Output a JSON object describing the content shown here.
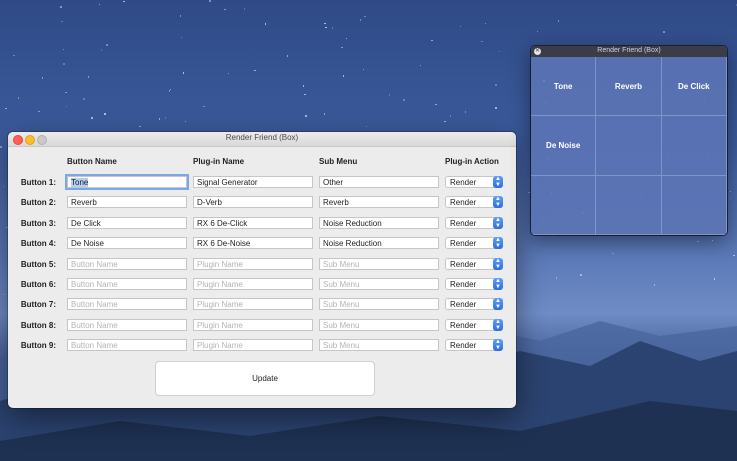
{
  "main_window": {
    "title": "Render Friend (Box)",
    "headers": {
      "button_name": "Button Name",
      "plugin_name": "Plug-in Name",
      "sub_menu": "Sub Menu",
      "plugin_action": "Plug-in Action"
    },
    "rows": [
      {
        "label": "Button 1:",
        "button_name": "Tone",
        "plugin_name": "Signal Generator",
        "sub_menu": "Other",
        "action": "Render"
      },
      {
        "label": "Button 2:",
        "button_name": "Reverb",
        "plugin_name": "D-Verb",
        "sub_menu": "Reverb",
        "action": "Render"
      },
      {
        "label": "Button 3:",
        "button_name": "De Click",
        "plugin_name": "RX 6 De-Click",
        "sub_menu": "Noise Reduction",
        "action": "Render"
      },
      {
        "label": "Button 4:",
        "button_name": "De Noise",
        "plugin_name": "RX 6 De-Noise",
        "sub_menu": "Noise Reduction",
        "action": "Render"
      },
      {
        "label": "Button 5:",
        "button_name": "",
        "plugin_name": "",
        "sub_menu": "",
        "action": "Render"
      },
      {
        "label": "Button 6:",
        "button_name": "",
        "plugin_name": "",
        "sub_menu": "",
        "action": "Render"
      },
      {
        "label": "Button 7:",
        "button_name": "",
        "plugin_name": "",
        "sub_menu": "",
        "action": "Render"
      },
      {
        "label": "Button 8:",
        "button_name": "",
        "plugin_name": "",
        "sub_menu": "",
        "action": "Render"
      },
      {
        "label": "Button 9:",
        "button_name": "",
        "plugin_name": "",
        "sub_menu": "",
        "action": "Render"
      }
    ],
    "placeholders": {
      "button_name": "Button Name",
      "plugin_name": "Plugin Name",
      "sub_menu": "Sub Menu"
    },
    "update_label": "Update"
  },
  "hud_window": {
    "title": "Render Friend (Box)",
    "close_glyph": "✕",
    "buttons": [
      "Tone",
      "Reverb",
      "De Click",
      "De Noise",
      "",
      "",
      "",
      "",
      ""
    ]
  },
  "colors": {
    "accent": "#2d6de0",
    "focus_ring": "#7aa7ea"
  }
}
